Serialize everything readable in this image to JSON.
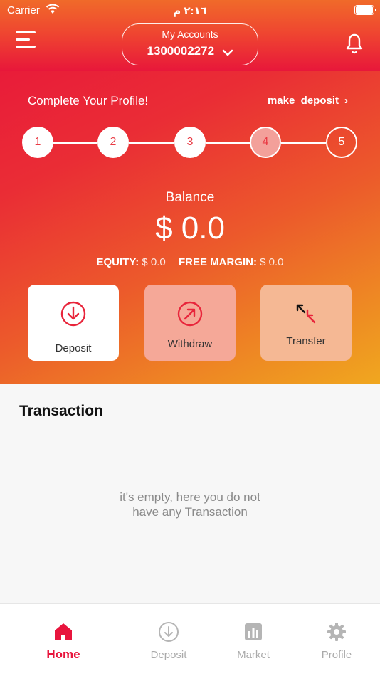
{
  "status_bar": {
    "carrier": "Carrier",
    "time": "٢:١٦ م"
  },
  "header": {
    "accounts_label": "My Accounts",
    "account_number": "1300002272"
  },
  "profile": {
    "title": "Complete Your Profile!",
    "next_step_link": "make_deposit",
    "steps": [
      "1",
      "2",
      "3",
      "4",
      "5"
    ],
    "current_step": 4
  },
  "balance": {
    "label": "Balance",
    "value": "$ 0.0",
    "equity_label": "EQUITY:",
    "equity_value": "$ 0.0",
    "free_margin_label": "FREE MARGIN:",
    "free_margin_value": "$ 0.0"
  },
  "actions": {
    "deposit": "Deposit",
    "withdraw": "Withdraw",
    "transfer": "Transfer"
  },
  "transactions": {
    "title": "Transaction",
    "empty_line1": "it's empty, here you do not",
    "empty_line2": "have any Transaction"
  },
  "tabbar": {
    "items": [
      {
        "label": "Home",
        "icon": "home-icon",
        "active": true
      },
      {
        "label": "Deposit",
        "icon": "deposit-icon",
        "active": false
      },
      {
        "label": "Market",
        "icon": "market-icon",
        "active": false
      },
      {
        "label": "Profile",
        "icon": "gear-icon",
        "active": false
      }
    ]
  },
  "colors": {
    "accent": "#e8153d",
    "gradient_start": "#e8123c",
    "gradient_end": "#f0a71f"
  }
}
